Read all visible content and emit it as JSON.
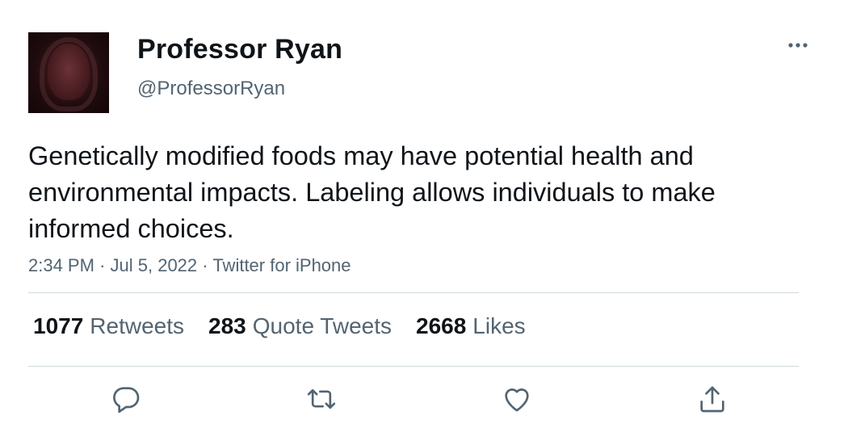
{
  "user": {
    "display_name": "Professor Ryan",
    "handle": "@ProfessorRyan"
  },
  "tweet": {
    "text": "Genetically modified foods may have potential health and environmental impacts. Labeling allows individuals to make informed choices.",
    "time": "2:34 PM",
    "separator": "·",
    "date": "Jul 5, 2022",
    "source": "Twitter for iPhone"
  },
  "stats": {
    "retweets": {
      "count": "1077",
      "label": "Retweets"
    },
    "quotes": {
      "count": "283",
      "label": "Quote Tweets"
    },
    "likes": {
      "count": "2668",
      "label": "Likes"
    }
  },
  "icons": {
    "more": "more-dots-icon",
    "reply": "reply-icon",
    "retweet": "retweet-icon",
    "like": "heart-icon",
    "share": "share-icon"
  },
  "colors": {
    "text_primary": "#0f1419",
    "text_secondary": "#536471",
    "divider": "#cfd9de"
  }
}
